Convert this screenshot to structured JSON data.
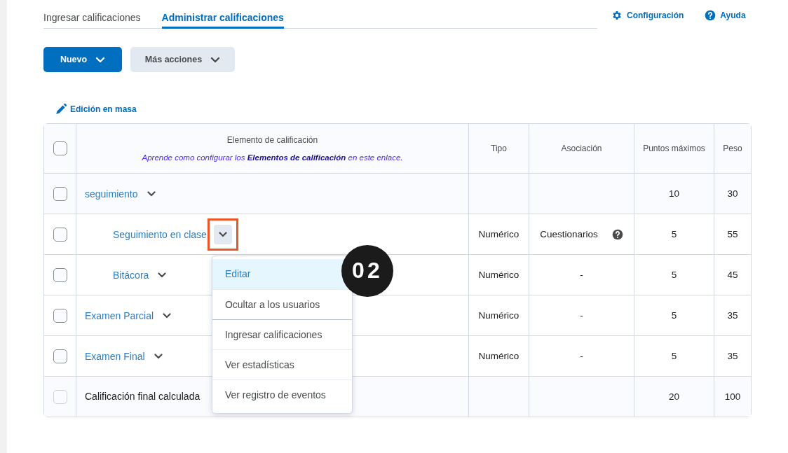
{
  "tabs": [
    {
      "label": "Ingresar calificaciones",
      "selected": false
    },
    {
      "label": "Administrar calificaciones",
      "selected": true
    }
  ],
  "top_links": [
    {
      "label": "Configuración",
      "kind": "settings"
    },
    {
      "label": "Ayuda",
      "kind": "help"
    }
  ],
  "buttons": [
    {
      "label": "Nuevo",
      "kind": "primary"
    },
    {
      "label": "Más acciones",
      "kind": "secondary"
    }
  ],
  "bulk_edit": "Edición en masa",
  "table": {
    "select_all_checked": false,
    "columns": [
      {
        "label": "Elemento de calificación",
        "hint": "Aprende como configurar los **Elementos de calificación** en este enlace."
      },
      {
        "label": "Tipo"
      },
      {
        "label": "Asociación"
      },
      {
        "label": "Puntos máximos"
      },
      {
        "label": "Peso"
      }
    ],
    "rows": [
      {
        "name": "seguimiento",
        "kind": "link",
        "checked": false,
        "max_points": "10",
        "weight": "30",
        "menu_open": false,
        "children": [
          {
            "name": "Seguimiento en clase",
            "kind": "link",
            "checked": false,
            "type": "Numérico",
            "association": "Cuestionarios",
            "association_help": true,
            "max_points": "5",
            "weight": "55",
            "menu_open": true
          },
          {
            "name": "Bitácora",
            "kind": "link",
            "checked": false,
            "type": "Numérico",
            "association": "-",
            "max_points": "5",
            "weight": "45",
            "menu_open": false
          }
        ]
      },
      {
        "name": "Examen Parcial",
        "kind": "link",
        "checked": false,
        "type": "Numérico",
        "association": "-",
        "max_points": "5",
        "weight": "35",
        "menu_open": false
      },
      {
        "name": "Examen Final",
        "kind": "link",
        "checked": false,
        "type": "Numérico",
        "association": "-",
        "max_points": "5",
        "weight": "35",
        "menu_open": false
      },
      {
        "name": "Calificación final calculada",
        "kind": "total",
        "checked": false,
        "disabled": true,
        "max_points": "20",
        "weight": "100"
      }
    ]
  },
  "menu": {
    "items": [
      {
        "label": "Editar",
        "selected": true,
        "group_start": false
      },
      {
        "label": "Ocultar a los usuarios",
        "selected": false,
        "group_start": false
      },
      {
        "label": "Ingresar calificaciones",
        "selected": false,
        "group_start": true
      },
      {
        "label": "Ver estadísticas",
        "selected": false,
        "group_start": false
      },
      {
        "label": "Ver registro de eventos",
        "selected": false,
        "group_start": false
      }
    ]
  },
  "step_badge": "02"
}
